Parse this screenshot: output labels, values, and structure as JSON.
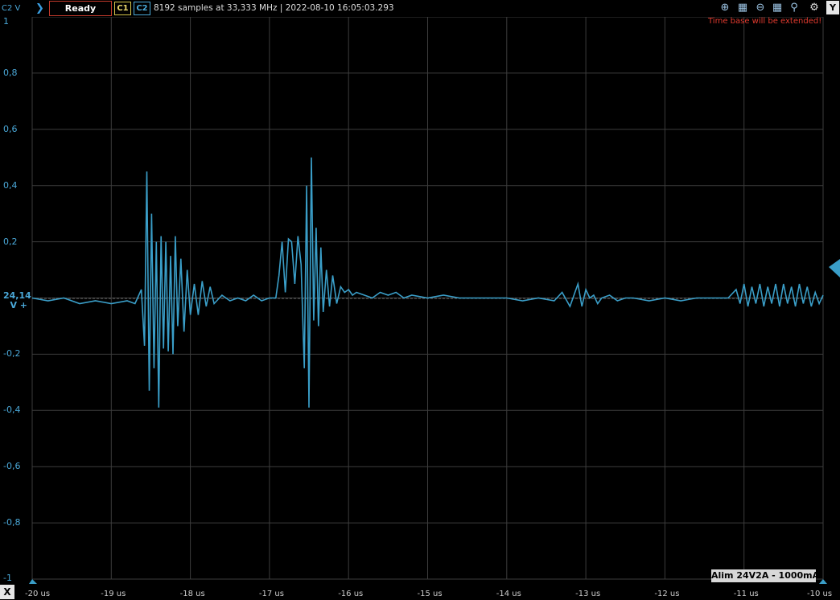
{
  "toolbar": {
    "channel_axis_label": "C2 V",
    "status": "Ready",
    "ch1_label": "C1",
    "ch2_label": "C2",
    "info": "8192 samples at 33,333 MHz | 2022-08-10 16:05:03.293",
    "y_button": "Y"
  },
  "warning": "Time base will be extended!",
  "y_ticks": [
    "1",
    "0,8",
    "0,6",
    "0,4",
    "0,2",
    "-0,2",
    "-0,4",
    "-0,6",
    "-0,8",
    "-1"
  ],
  "marker": {
    "value": "24,14",
    "label": "V +"
  },
  "x_axis_button": "X",
  "x_ticks": [
    "-20 us",
    "-19 us",
    "-18 us",
    "-17 us",
    "-16 us",
    "-15 us",
    "-14 us",
    "-13 us",
    "-12 us",
    "-11 us",
    "-10 us"
  ],
  "badge": "Alim 24V2A - 1000mA",
  "colors": {
    "trace": "#3a9ec8",
    "grid": "#3d3d3d",
    "status_border": "#c0392b",
    "warning": "#e03a2e"
  },
  "chart_data": {
    "type": "line",
    "xlabel": "",
    "ylabel": "C2 V",
    "xlim": [
      -20,
      -10
    ],
    "ylim": [
      -1,
      1
    ],
    "grid": true,
    "series": [
      {
        "x": [
          -20.0,
          -19.8,
          -19.6,
          -19.4,
          -19.2,
          -19.0,
          -18.8,
          -18.7,
          -18.62,
          -18.58,
          -18.55,
          -18.52,
          -18.49,
          -18.46,
          -18.43,
          -18.4,
          -18.37,
          -18.34,
          -18.31,
          -18.28,
          -18.25,
          -18.22,
          -18.19,
          -18.16,
          -18.12,
          -18.08,
          -18.04,
          -18.0,
          -17.95,
          -17.9,
          -17.85,
          -17.8,
          -17.75,
          -17.7,
          -17.6,
          -17.5,
          -17.4,
          -17.3,
          -17.2,
          -17.1,
          -17.0,
          -16.92,
          -16.88,
          -16.84,
          -16.8,
          -16.76,
          -16.72,
          -16.68,
          -16.64,
          -16.6,
          -16.56,
          -16.53,
          -16.5,
          -16.47,
          -16.44,
          -16.41,
          -16.38,
          -16.35,
          -16.32,
          -16.28,
          -16.24,
          -16.2,
          -16.15,
          -16.1,
          -16.05,
          -16.0,
          -15.95,
          -15.9,
          -15.8,
          -15.7,
          -15.6,
          -15.5,
          -15.4,
          -15.3,
          -15.2,
          -15.0,
          -14.8,
          -14.6,
          -14.4,
          -14.2,
          -14.0,
          -13.8,
          -13.6,
          -13.4,
          -13.3,
          -13.2,
          -13.1,
          -13.05,
          -13.0,
          -12.95,
          -12.9,
          -12.85,
          -12.8,
          -12.7,
          -12.6,
          -12.5,
          -12.4,
          -12.2,
          -12.0,
          -11.8,
          -11.6,
          -11.4,
          -11.2,
          -11.1,
          -11.05,
          -11.0,
          -10.95,
          -10.9,
          -10.85,
          -10.8,
          -10.75,
          -10.7,
          -10.65,
          -10.6,
          -10.55,
          -10.5,
          -10.45,
          -10.4,
          -10.35,
          -10.3,
          -10.25,
          -10.2,
          -10.15,
          -10.1,
          -10.05,
          -10.0
        ],
        "y": [
          0.0,
          -0.01,
          0.0,
          -0.02,
          -0.01,
          -0.02,
          -0.01,
          -0.02,
          0.03,
          -0.17,
          0.45,
          -0.33,
          0.3,
          -0.25,
          0.2,
          -0.39,
          0.22,
          -0.18,
          0.2,
          -0.19,
          0.15,
          -0.2,
          0.22,
          -0.1,
          0.14,
          -0.12,
          0.1,
          -0.06,
          0.05,
          -0.06,
          0.06,
          -0.03,
          0.04,
          -0.02,
          0.01,
          -0.01,
          0.0,
          -0.01,
          0.01,
          -0.01,
          0.0,
          0.0,
          0.08,
          0.2,
          0.02,
          0.21,
          0.2,
          0.05,
          0.22,
          0.12,
          -0.25,
          0.4,
          -0.39,
          0.5,
          -0.08,
          0.25,
          -0.1,
          0.18,
          -0.05,
          0.1,
          -0.03,
          0.08,
          -0.02,
          0.04,
          0.02,
          0.03,
          0.01,
          0.02,
          0.01,
          0.0,
          0.02,
          0.01,
          0.02,
          0.0,
          0.01,
          0.0,
          0.01,
          0.0,
          0.0,
          0.0,
          0.0,
          -0.01,
          0.0,
          -0.01,
          0.02,
          -0.03,
          0.05,
          -0.03,
          0.03,
          0.0,
          0.01,
          -0.02,
          0.0,
          0.01,
          -0.01,
          0.0,
          0.0,
          -0.01,
          0.0,
          -0.01,
          0.0,
          0.0,
          0.0,
          0.03,
          -0.02,
          0.05,
          -0.03,
          0.04,
          -0.02,
          0.05,
          -0.03,
          0.04,
          -0.02,
          0.05,
          -0.03,
          0.05,
          -0.02,
          0.04,
          -0.03,
          0.05,
          -0.02,
          0.04,
          -0.03,
          0.02,
          -0.02,
          0.01
        ]
      }
    ]
  }
}
